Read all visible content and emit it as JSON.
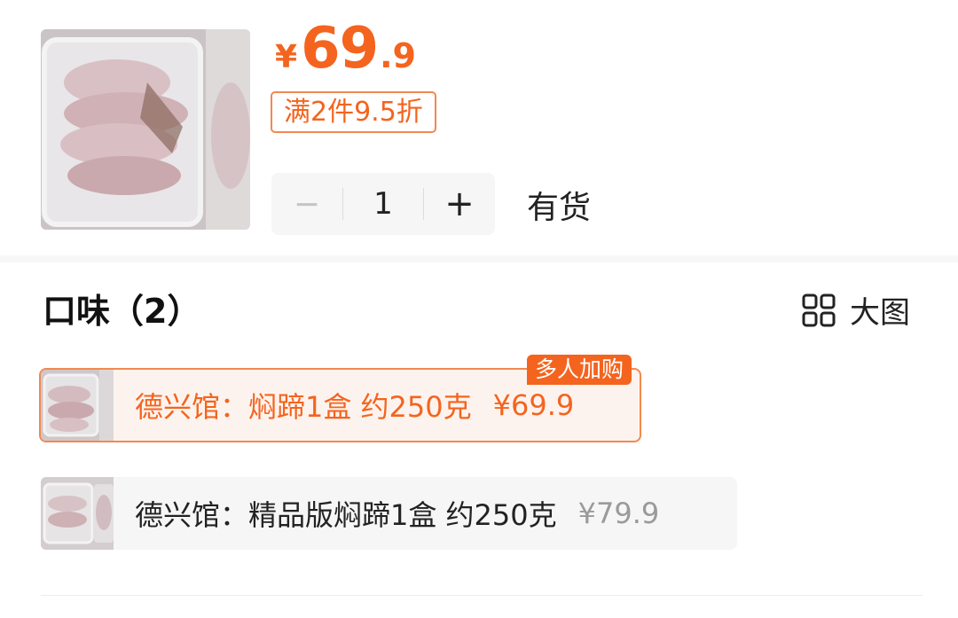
{
  "product": {
    "price_symbol": "¥",
    "price_int": "69",
    "price_dec": ".9",
    "promo_tag": "满2件9.5折",
    "quantity": "1",
    "minus_label": "−",
    "plus_label": "+",
    "stock_status": "有货"
  },
  "flavor": {
    "title": "口味（2）",
    "big_view_label": "大图",
    "options": [
      {
        "name": "德兴馆：焖蹄1盒 约250克",
        "price": "¥69.9",
        "selected": true,
        "badge": "多人加购"
      },
      {
        "name": "德兴馆：精品版焖蹄1盒 约250克",
        "price": "¥79.9",
        "selected": false
      }
    ]
  },
  "colors": {
    "accent": "#f4641e",
    "accent_border": "#f2894f",
    "selected_bg": "#fdf3ee",
    "muted_text": "#9a9a9a"
  },
  "icons": {
    "big_view": "grid-icon"
  }
}
